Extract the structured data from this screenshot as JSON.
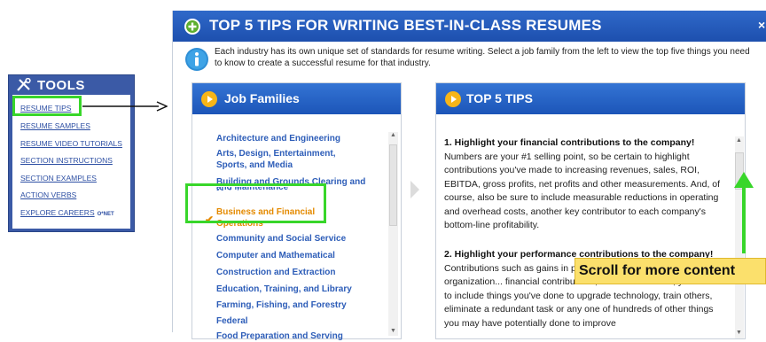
{
  "tools": {
    "title": "TOOLS",
    "items": [
      "RESUME TIPS",
      "RESUME SAMPLES",
      "RESUME VIDEO TUTORIALS",
      "SECTION INSTRUCTIONS",
      "SECTION EXAMPLES",
      "ACTION VERBS",
      "EXPLORE CAREERS"
    ],
    "explore_badge": "O*NET"
  },
  "main": {
    "title": "TOP 5 TIPS FOR WRITING BEST-IN-CLASS RESUMES",
    "intro": "Each industry has its own unique set of standards for resume writing. Select a job family from the left to view the top five things you need to know to create a successful resume for that industry.",
    "close_label": "×"
  },
  "job_families": {
    "title": "Job Families",
    "items": [
      "Architecture and Engineering",
      "Arts, Design, Entertainment, Sports, and Media",
      "Building and Grounds Clearing and Maintenance",
      "Business and Financial Operations",
      "Community and Social Service",
      "Computer and Mathematical",
      "Construction and Extraction",
      "Education, Training, and Library",
      "Farming, Fishing, and Forestry",
      "Federal",
      "Food Preparation and Serving"
    ],
    "selected_index": 3
  },
  "top_tips": {
    "title": "TOP 5 TIPS",
    "tip1_heading": "1. Highlight your financial contributions to the company!",
    "tip1_body": "Numbers are your #1 selling point, so be certain to highlight contributions you've made to increasing revenues, sales, ROI, EBITDA, gross profits, net profits and other measurements. And, of course, also be sure to include measurable reductions in operating and overhead costs, another key contributor to each company's bottom-line profitability.",
    "tip2_heading": "2. Highlight your performance contributions to the company!",
    "tip2_body": "Contributions such as gains in pro... management and organization... financial contributions, so be s... addition, you'll want to include things you've done to upgrade technology, train others, eliminate a redundant task or any one of hundreds of other things you may have potentially done to improve"
  },
  "callout": {
    "text": "Scroll for more content"
  },
  "colors": {
    "header_blue": "#1d4fae",
    "link_blue": "#2d5db8",
    "selected_orange": "#e48a00",
    "highlight_green": "#38d62a",
    "callout_yellow": "#fbe06c"
  }
}
